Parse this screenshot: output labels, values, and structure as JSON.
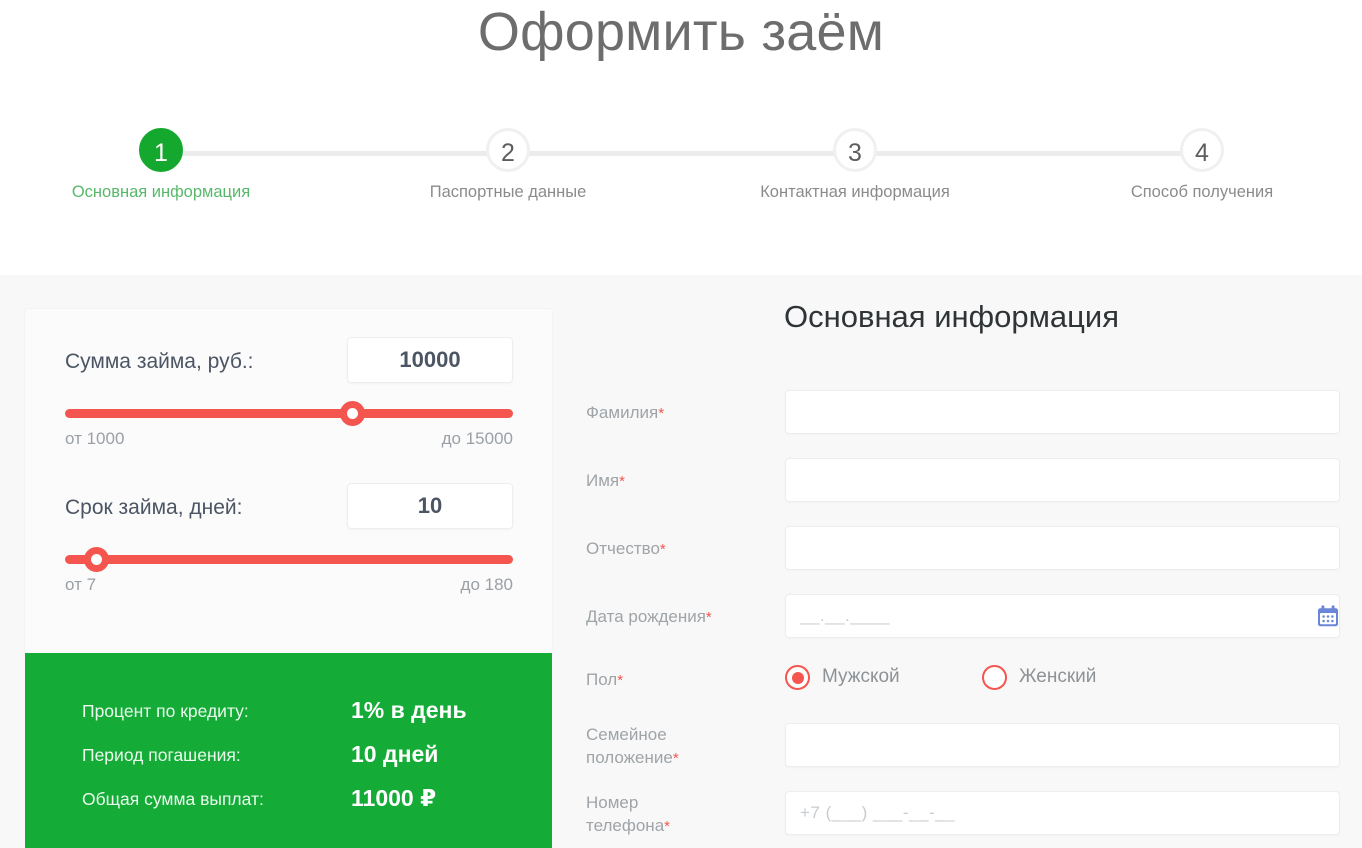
{
  "header": {
    "title": "Оформить заём"
  },
  "steps": [
    {
      "number": "1",
      "label": "Основная информация",
      "active": true
    },
    {
      "number": "2",
      "label": "Паспортные данные",
      "active": false
    },
    {
      "number": "3",
      "label": "Контактная информация",
      "active": false
    },
    {
      "number": "4",
      "label": "Способ получения",
      "active": false
    }
  ],
  "calculator": {
    "amount": {
      "label": "Сумма займа, руб.:",
      "value": "10000",
      "min_label": "от 1000",
      "max_label": "до 15000",
      "min": 1000,
      "max": 15000,
      "fill_percent": 64
    },
    "term": {
      "label": "Срок займа, дней:",
      "value": "10",
      "min_label": "от 7",
      "max_label": "до 180",
      "min": 7,
      "max": 180,
      "fill_percent": 7
    }
  },
  "summary": {
    "rows": [
      {
        "key": "Процент по кредиту:",
        "value": "1% в день"
      },
      {
        "key": "Период погашения:",
        "value": "10 дней"
      },
      {
        "key": "Общая сумма выплат:",
        "value": "11000 ₽"
      }
    ]
  },
  "form": {
    "title": "Основная информация",
    "required_mark": "*",
    "fields": {
      "lastname": {
        "label": "Фамилия",
        "value": "",
        "placeholder": ""
      },
      "firstname": {
        "label": "Имя",
        "value": "",
        "placeholder": ""
      },
      "patronymic": {
        "label": "Отчество",
        "value": "",
        "placeholder": ""
      },
      "birthdate": {
        "label": "Дата рождения",
        "value": "",
        "placeholder": "__.__.____",
        "icon": "calendar-icon"
      },
      "gender": {
        "label": "Пол",
        "options": [
          {
            "label": "Мужской",
            "checked": true
          },
          {
            "label": "Женский",
            "checked": false
          }
        ]
      },
      "marital": {
        "label_line1": "Семейное",
        "label_line2": "положение",
        "value": "",
        "placeholder": ""
      },
      "phone": {
        "label_line1": "Номер",
        "label_line2": "телефона",
        "value": "",
        "placeholder": "+7 (___) ___-__-__"
      }
    }
  },
  "colors": {
    "accent_green": "#14ab36",
    "accent_red": "#f4564f",
    "step_active": "#14a82e",
    "calendar_blue": "#6b85d8",
    "page_bg": "#f8f8f8"
  }
}
